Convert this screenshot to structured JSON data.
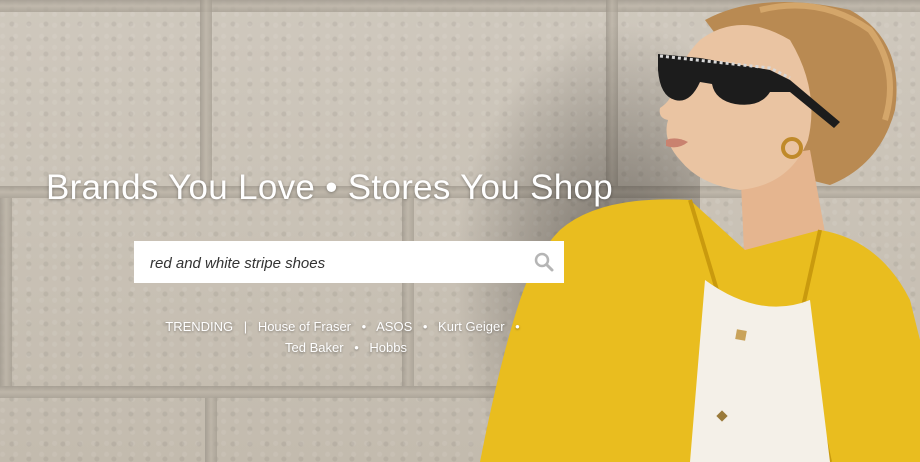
{
  "hero": {
    "headline": "Brands You Love • Stores You Shop",
    "search": {
      "value": "red and white stripe shoes",
      "icon": "search-icon"
    },
    "trending": {
      "label": "TRENDING",
      "divider": "|",
      "bullet": "•",
      "brands": [
        "House of Fraser",
        "ASOS",
        "Kurt Geiger",
        "Ted Baker",
        "Hobbs"
      ]
    }
  },
  "colors": {
    "jacket": "#e9bd1f",
    "text": "#ffffff",
    "wall": "#c9c2b6"
  }
}
